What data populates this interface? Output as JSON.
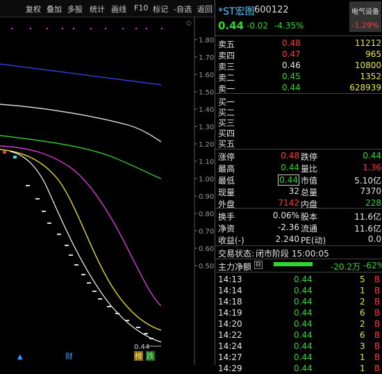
{
  "toolbar": {
    "items": [
      "复权",
      "叠加",
      "多股",
      "统计",
      "画线",
      "F10",
      "标记",
      "-自选",
      "返回"
    ]
  },
  "chart": {
    "y_ticks": [
      "1.80",
      "1.70",
      "1.60",
      "1.50",
      "1.40",
      "1.30",
      "1.20",
      "1.10",
      "1.00",
      "0.90",
      "0.80",
      "0.70",
      "0.60",
      "0.50"
    ],
    "last_price_label": "0.44",
    "marker_cai": "财",
    "marker_bang": "榜",
    "marker_die": "跌"
  },
  "chart_data": {
    "type": "line",
    "y_axis_ticks": [
      1.8,
      1.7,
      1.6,
      1.5,
      1.4,
      1.3,
      1.2,
      1.1,
      1.0,
      0.9,
      0.8,
      0.7,
      0.6,
      0.5
    ],
    "ylim": [
      0.44,
      1.86
    ],
    "series": [],
    "last_price": 0.44
  },
  "quote": {
    "name": "*ST宏图",
    "code": "600122",
    "sector_name": "电气设备",
    "sector_change": "-1.29%",
    "price": "0.44",
    "change": "-0.02",
    "change_pct": "-4.35%",
    "asks": [
      {
        "label": "卖五",
        "price": "0.48",
        "vol": "11212"
      },
      {
        "label": "卖四",
        "price": "0.47",
        "vol": "965"
      },
      {
        "label": "卖三",
        "price": "0.46",
        "vol": "10800"
      },
      {
        "label": "卖二",
        "price": "0.45",
        "vol": "1352"
      },
      {
        "label": "卖一",
        "price": "0.44",
        "vol": "628939"
      }
    ],
    "bids": [
      {
        "label": "买一"
      },
      {
        "label": "买二"
      },
      {
        "label": "买三"
      },
      {
        "label": "买四"
      },
      {
        "label": "买五"
      }
    ],
    "stats": [
      {
        "k1": "涨停",
        "v1": "0.48",
        "k2": "跌停",
        "v2": "0.44"
      },
      {
        "k1": "最高",
        "v1": "0.44",
        "k2": "量比",
        "v2": "1.36"
      },
      {
        "k1": "最低",
        "v1": "0.44",
        "k2": "市值",
        "v2": "5.10亿"
      },
      {
        "k1": "现量",
        "v1": "32",
        "k2": "总量",
        "v2": "7370"
      },
      {
        "k1": "外盘",
        "v1": "7142",
        "k2": "内盘",
        "v2": "228"
      }
    ],
    "fund": [
      {
        "k1": "换手",
        "v1": "0.06%",
        "k2": "股本",
        "v2": "11.6亿"
      },
      {
        "k1": "净资",
        "v1": "-2.36",
        "k2": "流通",
        "v2": "11.6亿"
      },
      {
        "k1": "收益(-)",
        "v1": "2.240",
        "k2": "PE(动)",
        "v2": "0.0"
      }
    ],
    "trade_status_label": "交易状态:",
    "trade_status": "闭市阶段 15:00:05",
    "main_flow_label": "主力净额",
    "main_flow_value": "-20.2万",
    "main_flow_pct": "-62%",
    "ticks": [
      {
        "time": "14:13",
        "price": "0.44",
        "vol": "5",
        "side": "B"
      },
      {
        "time": "14:14",
        "price": "0.44",
        "vol": "1",
        "side": "B"
      },
      {
        "time": "14:18",
        "price": "0.44",
        "vol": "2",
        "side": "B"
      },
      {
        "time": "14:19",
        "price": "0.44",
        "vol": "6",
        "side": "B"
      },
      {
        "time": "14:20",
        "price": "0.44",
        "vol": "2",
        "side": "B"
      },
      {
        "time": "14:22",
        "price": "0.44",
        "vol": "6",
        "side": "B"
      },
      {
        "time": "14:24",
        "price": "0.44",
        "vol": "3",
        "side": "B"
      },
      {
        "time": "14:27",
        "price": "0.44",
        "vol": "1",
        "side": "B"
      },
      {
        "time": "14:29",
        "price": "0.44",
        "vol": "1",
        "side": "B"
      }
    ]
  }
}
